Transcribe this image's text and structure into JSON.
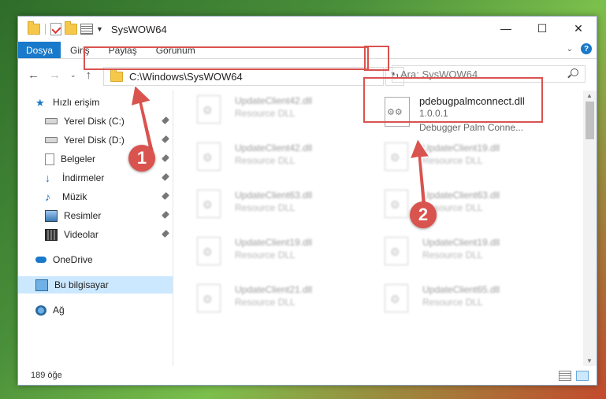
{
  "window": {
    "title": "SysWOW64"
  },
  "ribbon": {
    "tabs": [
      "Dosya",
      "Giriş",
      "Paylaş",
      "Görünüm"
    ],
    "help": "?"
  },
  "captions": {
    "minimize": "—",
    "maximize": "☐",
    "close": "✕"
  },
  "address": {
    "path": "C:\\Windows\\SysWOW64"
  },
  "search": {
    "placeholder": "Ara: SysWOW64"
  },
  "nav_pane": {
    "items": [
      {
        "label": "Hızlı erişim",
        "icon": "star-icon"
      },
      {
        "label": "Yerel Disk (C:)",
        "icon": "disk-icon"
      },
      {
        "label": "Yerel Disk (D:)",
        "icon": "disk-icon"
      },
      {
        "label": "Belgeler",
        "icon": "document-icon"
      },
      {
        "label": "İndirmeler",
        "icon": "download-icon"
      },
      {
        "label": "Müzik",
        "icon": "music-icon"
      },
      {
        "label": "Resimler",
        "icon": "picture-icon"
      },
      {
        "label": "Videolar",
        "icon": "video-icon"
      },
      {
        "label": "OneDrive",
        "icon": "cloud-icon"
      },
      {
        "label": "Bu bilgisayar",
        "icon": "computer-icon"
      },
      {
        "label": "Ağ",
        "icon": "network-icon"
      }
    ]
  },
  "files": {
    "left": [
      {
        "name": "UpdateClient42.dll",
        "type": "Resource DLL"
      },
      {
        "name": "UpdateClient42.dll",
        "type": "Resource DLL"
      },
      {
        "name": "UpdateClient63.dll",
        "type": "Resource DLL"
      },
      {
        "name": "UpdateClient19.dll",
        "type": "Resource DLL"
      },
      {
        "name": "UpdateClient21.dll",
        "type": "Resource DLL"
      }
    ],
    "right": [
      {
        "name": "UpdateClient19.dll",
        "type": "Resource DLL"
      },
      {
        "name": "UpdateClient63.dll",
        "type": "Resource DLL"
      },
      {
        "name": "UpdateClient19.dll",
        "type": "Resource DLL"
      },
      {
        "name": "UpdateClient65.dll",
        "type": "Resource DLL"
      }
    ],
    "highlighted": {
      "name": "pdebugpalmconnect.dll",
      "version": "1.0.0.1",
      "description": "Debugger Palm Conne..."
    }
  },
  "status": {
    "count": "189 öğe"
  },
  "callouts": {
    "one": "1",
    "two": "2"
  },
  "colors": {
    "accent": "#1979ca",
    "highlight": "#d9534f",
    "selection": "#cce8ff"
  }
}
